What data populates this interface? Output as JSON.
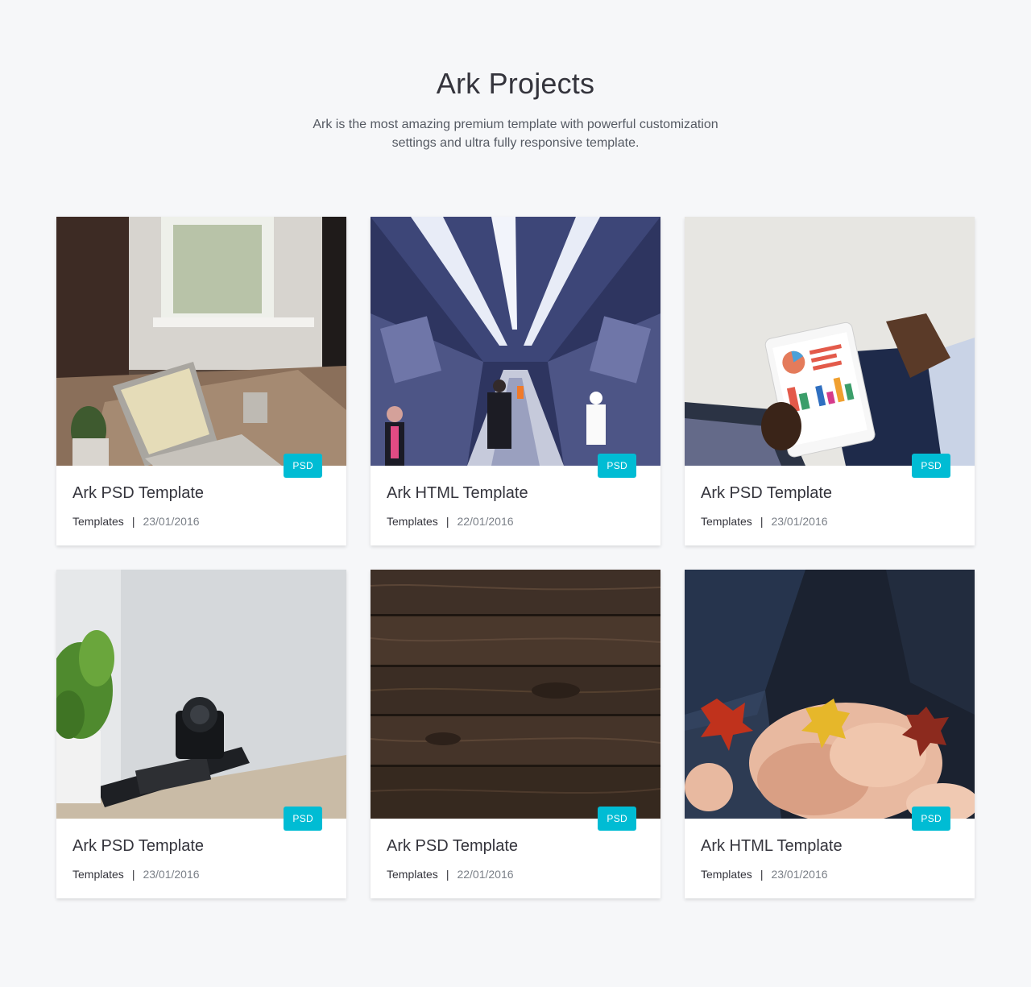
{
  "section": {
    "title": "Ark Projects",
    "subtitle": "Ark is the most amazing premium template with powerful customization settings and ultra fully responsive template."
  },
  "colors": {
    "accent": "#00bcd4",
    "background": "#f6f7f9"
  },
  "projects": [
    {
      "title": "Ark PSD Template",
      "category": "Templates",
      "separator": "|",
      "date": "23/01/2016",
      "badge": "PSD",
      "image": "laptop-desk-photo"
    },
    {
      "title": "Ark HTML Template",
      "category": "Templates",
      "separator": "|",
      "date": "22/01/2016",
      "badge": "PSD",
      "image": "subway-escalator-photo"
    },
    {
      "title": "Ark PSD Template",
      "category": "Templates",
      "separator": "|",
      "date": "23/01/2016",
      "badge": "PSD",
      "image": "tablet-charts-photo"
    },
    {
      "title": "Ark PSD Template",
      "category": "Templates",
      "separator": "|",
      "date": "23/01/2016",
      "badge": "PSD",
      "image": "camera-plant-photo"
    },
    {
      "title": "Ark PSD Template",
      "category": "Templates",
      "separator": "|",
      "date": "22/01/2016",
      "badge": "PSD",
      "image": "wood-texture-photo"
    },
    {
      "title": "Ark HTML Template",
      "category": "Templates",
      "separator": "|",
      "date": "23/01/2016",
      "badge": "PSD",
      "image": "autumn-leaves-hands-photo"
    }
  ]
}
